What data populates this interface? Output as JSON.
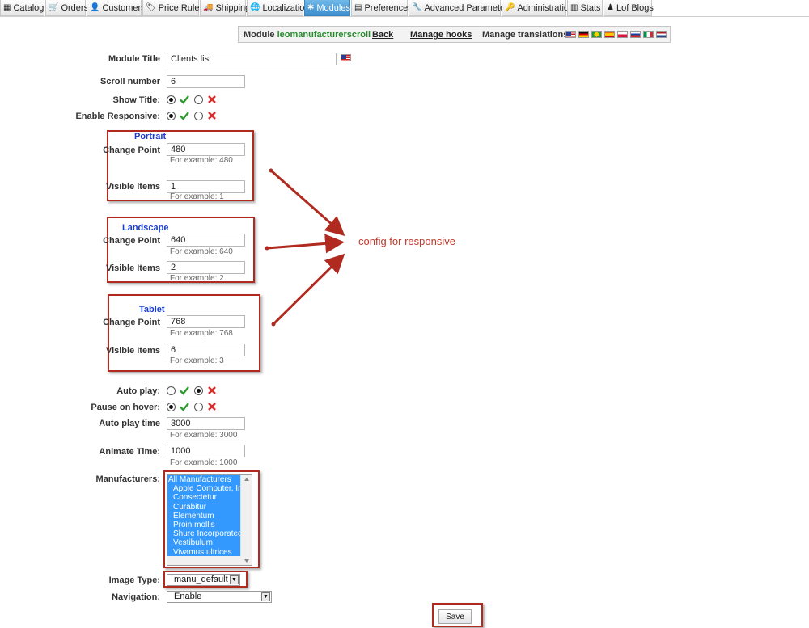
{
  "tabs": [
    {
      "label": "Catalog",
      "icon": "catalog-icon"
    },
    {
      "label": "Orders",
      "icon": "cart-icon"
    },
    {
      "label": "Customers",
      "icon": "customers-icon"
    },
    {
      "label": "Price Rules",
      "icon": "price-tag-icon"
    },
    {
      "label": "Shipping",
      "icon": "truck-icon"
    },
    {
      "label": "Localization",
      "icon": "globe-icon"
    },
    {
      "label": "Modules",
      "icon": "puzzle-icon",
      "active": true
    },
    {
      "label": "Preferences",
      "icon": "preferences-icon"
    },
    {
      "label": "Advanced Parameters",
      "icon": "wrench-icon"
    },
    {
      "label": "Administration",
      "icon": "key-icon"
    },
    {
      "label": "Stats",
      "icon": "chart-icon"
    },
    {
      "label": "Lof Blogs",
      "icon": "blog-icon"
    }
  ],
  "toolbar": {
    "module_prefix": "Module",
    "module_name": "leomanufacturerscroll",
    "back": "Back",
    "manage_hooks": "Manage hooks",
    "manage_translations": "Manage translations",
    "flags": [
      "us",
      "de",
      "br",
      "es",
      "pl",
      "ru",
      "it",
      "nl"
    ]
  },
  "form": {
    "module_title": {
      "label": "Module Title",
      "value": "Clients list"
    },
    "scroll_number": {
      "label": "Scroll number",
      "value": "6"
    },
    "show_title": {
      "label": "Show Title:",
      "selected": "yes"
    },
    "enable_responsive": {
      "label": "Enable Responsive:",
      "selected": "yes"
    },
    "portrait": {
      "title": "Portrait",
      "change_point": {
        "label": "Change Point",
        "value": "480",
        "hint": "For example: 480"
      },
      "visible_items": {
        "label": "Visible Items",
        "value": "1",
        "hint": "For example: 1"
      }
    },
    "landscape": {
      "title": "Landscape",
      "change_point": {
        "label": "Change Point",
        "value": "640",
        "hint": "For example: 640"
      },
      "visible_items": {
        "label": "Visible Items",
        "value": "2",
        "hint": "For example: 2"
      }
    },
    "tablet": {
      "title": "Tablet",
      "change_point": {
        "label": "Change Point",
        "value": "768",
        "hint": "For example: 768"
      },
      "visible_items": {
        "label": "Visible Items",
        "value": "6",
        "hint": "For example: 3"
      }
    },
    "auto_play": {
      "label": "Auto play:",
      "selected": "no"
    },
    "pause_on_hover": {
      "label": "Pause on hover:",
      "selected": "yes"
    },
    "auto_play_time": {
      "label": "Auto play time",
      "value": "3000",
      "hint": "For example: 3000"
    },
    "animate_time": {
      "label": "Animate Time:",
      "value": "1000",
      "hint": "For example: 1000"
    },
    "manufacturers": {
      "label": "Manufacturers:",
      "options": [
        "All Manufacturers",
        "Apple Computer, Inc",
        "Consectetur",
        "Curabitur",
        "Elementum",
        "Proin mollis",
        "Shure Incorporated",
        "Vestibulum",
        "Vivamus ultrices"
      ]
    },
    "image_type": {
      "label": "Image Type:",
      "value": "manu_default"
    },
    "navigation": {
      "label": "Navigation:",
      "value": "Enable"
    },
    "save": "Save"
  },
  "annotation": "config for responsive",
  "colors": {
    "accent_tab": "#3d8fcf",
    "annotation_red": "#b02a20",
    "section_blue": "#1a3dd6",
    "module_green": "#268c2e"
  }
}
